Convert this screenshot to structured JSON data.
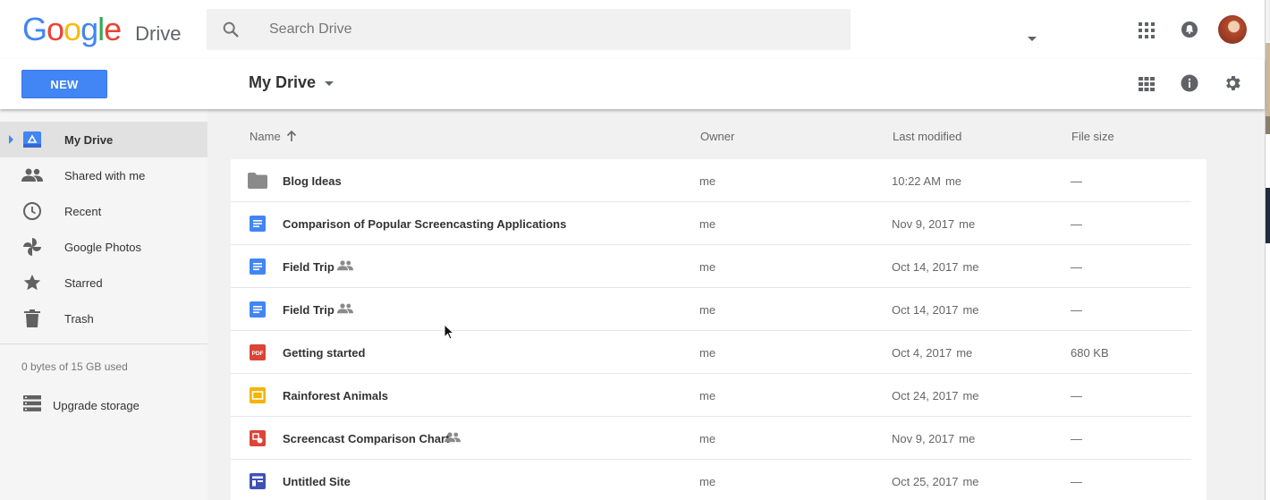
{
  "header": {
    "logo_text": "Google",
    "product_name": "Drive",
    "search_placeholder": "Search Drive",
    "icons": [
      "apps-grid-icon",
      "notifications-bell-icon",
      "account-avatar"
    ]
  },
  "toolbar": {
    "new_label": "NEW",
    "breadcrumb": "My Drive",
    "icons": [
      "grid-view-icon",
      "info-icon",
      "settings-gear-icon"
    ]
  },
  "sidebar": {
    "items": [
      {
        "label": "My Drive",
        "icon": "my-drive-icon",
        "active": true
      },
      {
        "label": "Shared with me",
        "icon": "people-icon",
        "active": false
      },
      {
        "label": "Recent",
        "icon": "clock-icon",
        "active": false
      },
      {
        "label": "Google Photos",
        "icon": "pinwheel-icon",
        "active": false
      },
      {
        "label": "Starred",
        "icon": "star-icon",
        "active": false
      },
      {
        "label": "Trash",
        "icon": "trash-icon",
        "active": false
      }
    ],
    "storage_text": "0 bytes of 15 GB used",
    "upgrade_label": "Upgrade storage"
  },
  "list": {
    "columns": {
      "name": "Name",
      "owner": "Owner",
      "modified": "Last modified",
      "size": "File size"
    },
    "rows": [
      {
        "name": "Blog Ideas",
        "type": "folder",
        "shared": false,
        "owner": "me",
        "modified": "10:22 AM",
        "modified_by": "me",
        "size": "—"
      },
      {
        "name": "Comparison of Popular Screencasting Applications",
        "type": "doc",
        "shared": false,
        "owner": "me",
        "modified": "Nov 9, 2017",
        "modified_by": "me",
        "size": "—"
      },
      {
        "name": "Field Trip",
        "type": "doc",
        "shared": true,
        "owner": "me",
        "modified": "Oct 14, 2017",
        "modified_by": "me",
        "size": "—"
      },
      {
        "name": "Field Trip",
        "type": "doc",
        "shared": true,
        "owner": "me",
        "modified": "Oct 14, 2017",
        "modified_by": "me",
        "size": "—"
      },
      {
        "name": "Getting started",
        "type": "pdf",
        "shared": false,
        "owner": "me",
        "modified": "Oct 4, 2017",
        "modified_by": "me",
        "size": "680 KB"
      },
      {
        "name": "Rainforest Animals",
        "type": "slides",
        "shared": false,
        "owner": "me",
        "modified": "Oct 24, 2017",
        "modified_by": "me",
        "size": "—"
      },
      {
        "name": "Screencast Comparison Chart",
        "type": "drawing",
        "shared": true,
        "owner": "me",
        "modified": "Nov 9, 2017",
        "modified_by": "me",
        "size": "—"
      },
      {
        "name": "Untitled Site",
        "type": "site",
        "shared": false,
        "owner": "me",
        "modified": "Oct 25, 2017",
        "modified_by": "me",
        "size": "—"
      }
    ]
  },
  "colors": {
    "accent": "#4285f4",
    "sidebar_bg": "#f5f5f5",
    "active_item_bg": "#e1e1e1",
    "doc_blue": "#4285f4",
    "pdf_red": "#db4437",
    "slides_yellow": "#f4b400",
    "site_indigo": "#3f51b5"
  },
  "pdf_badge": "PDF"
}
